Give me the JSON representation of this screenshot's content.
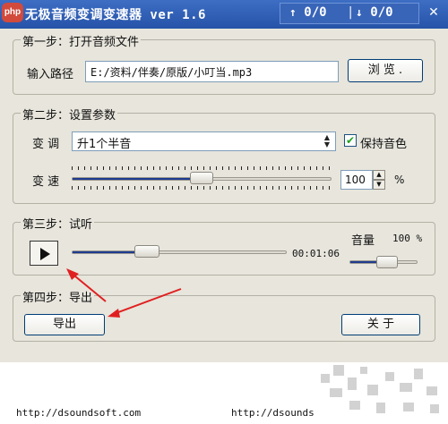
{
  "app": {
    "badge": "php",
    "title": "无极音频变调变速器 ver 1.6",
    "stats": {
      "up": "0/0",
      "down": "0/0"
    }
  },
  "step1": {
    "legend": "第一步：打开音频文件",
    "input_label": "输入路径",
    "path_value": "E:/资料/伴奏/原版/小叮当.mp3",
    "browse_label": "浏 览 ."
  },
  "step2": {
    "legend": "第二步：设置参数",
    "pitch_label": "变 调",
    "pitch_selected": "升1个半音",
    "keep_timbre_label": "保持音色",
    "keep_timbre_checked": true,
    "speed_label": "变 速",
    "speed_value": "100",
    "speed_unit": "%",
    "speed_fraction": 0.5
  },
  "step3": {
    "legend": "第三步：试听",
    "time": "00:01:06",
    "progress_fraction": 0.35,
    "volume_label": "音量",
    "volume_value": "100 %",
    "volume_fraction": 0.55
  },
  "step4": {
    "legend": "第四步：导出",
    "export_label": "导出",
    "about_label": "关 于"
  },
  "footer": {
    "url_left": "http://dsoundsoft.com",
    "url_right": "http://dsounds"
  },
  "colors": {
    "titlebar": "#2653a8",
    "window_bg": "#e7e5dc",
    "annotation_arrow": "#e02020",
    "slider_fill": "#1f3b8f"
  }
}
